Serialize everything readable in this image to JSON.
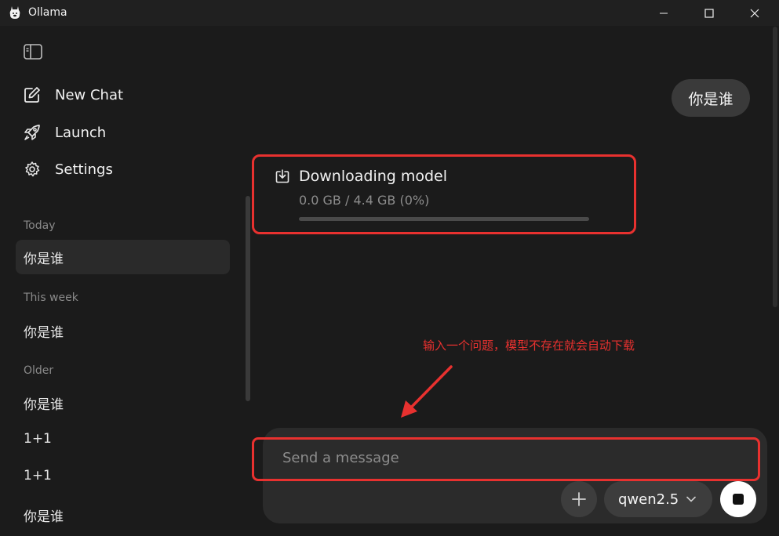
{
  "window": {
    "title": "Ollama"
  },
  "sidebar": {
    "nav": [
      {
        "label": "New Chat",
        "icon": "edit-icon"
      },
      {
        "label": "Launch",
        "icon": "rocket-icon"
      },
      {
        "label": "Settings",
        "icon": "gear-icon"
      }
    ],
    "sections": {
      "today": {
        "label": "Today",
        "items": [
          "你是谁"
        ]
      },
      "week": {
        "label": "This week",
        "items": [
          "你是谁"
        ]
      },
      "older": {
        "label": "Older",
        "items": [
          "你是谁",
          "1+1",
          "1+1",
          "你是谁"
        ]
      }
    }
  },
  "conversation": {
    "user_message": "你是谁",
    "download": {
      "title": "Downloading model",
      "status": "0.0 GB / 4.4 GB (0%)",
      "progress": 0
    }
  },
  "annotation": {
    "text": "输入一个问题，模型不存在就会自动下载",
    "color": "#e8312f"
  },
  "composer": {
    "placeholder": "Send a message",
    "model": "qwen2.5"
  }
}
